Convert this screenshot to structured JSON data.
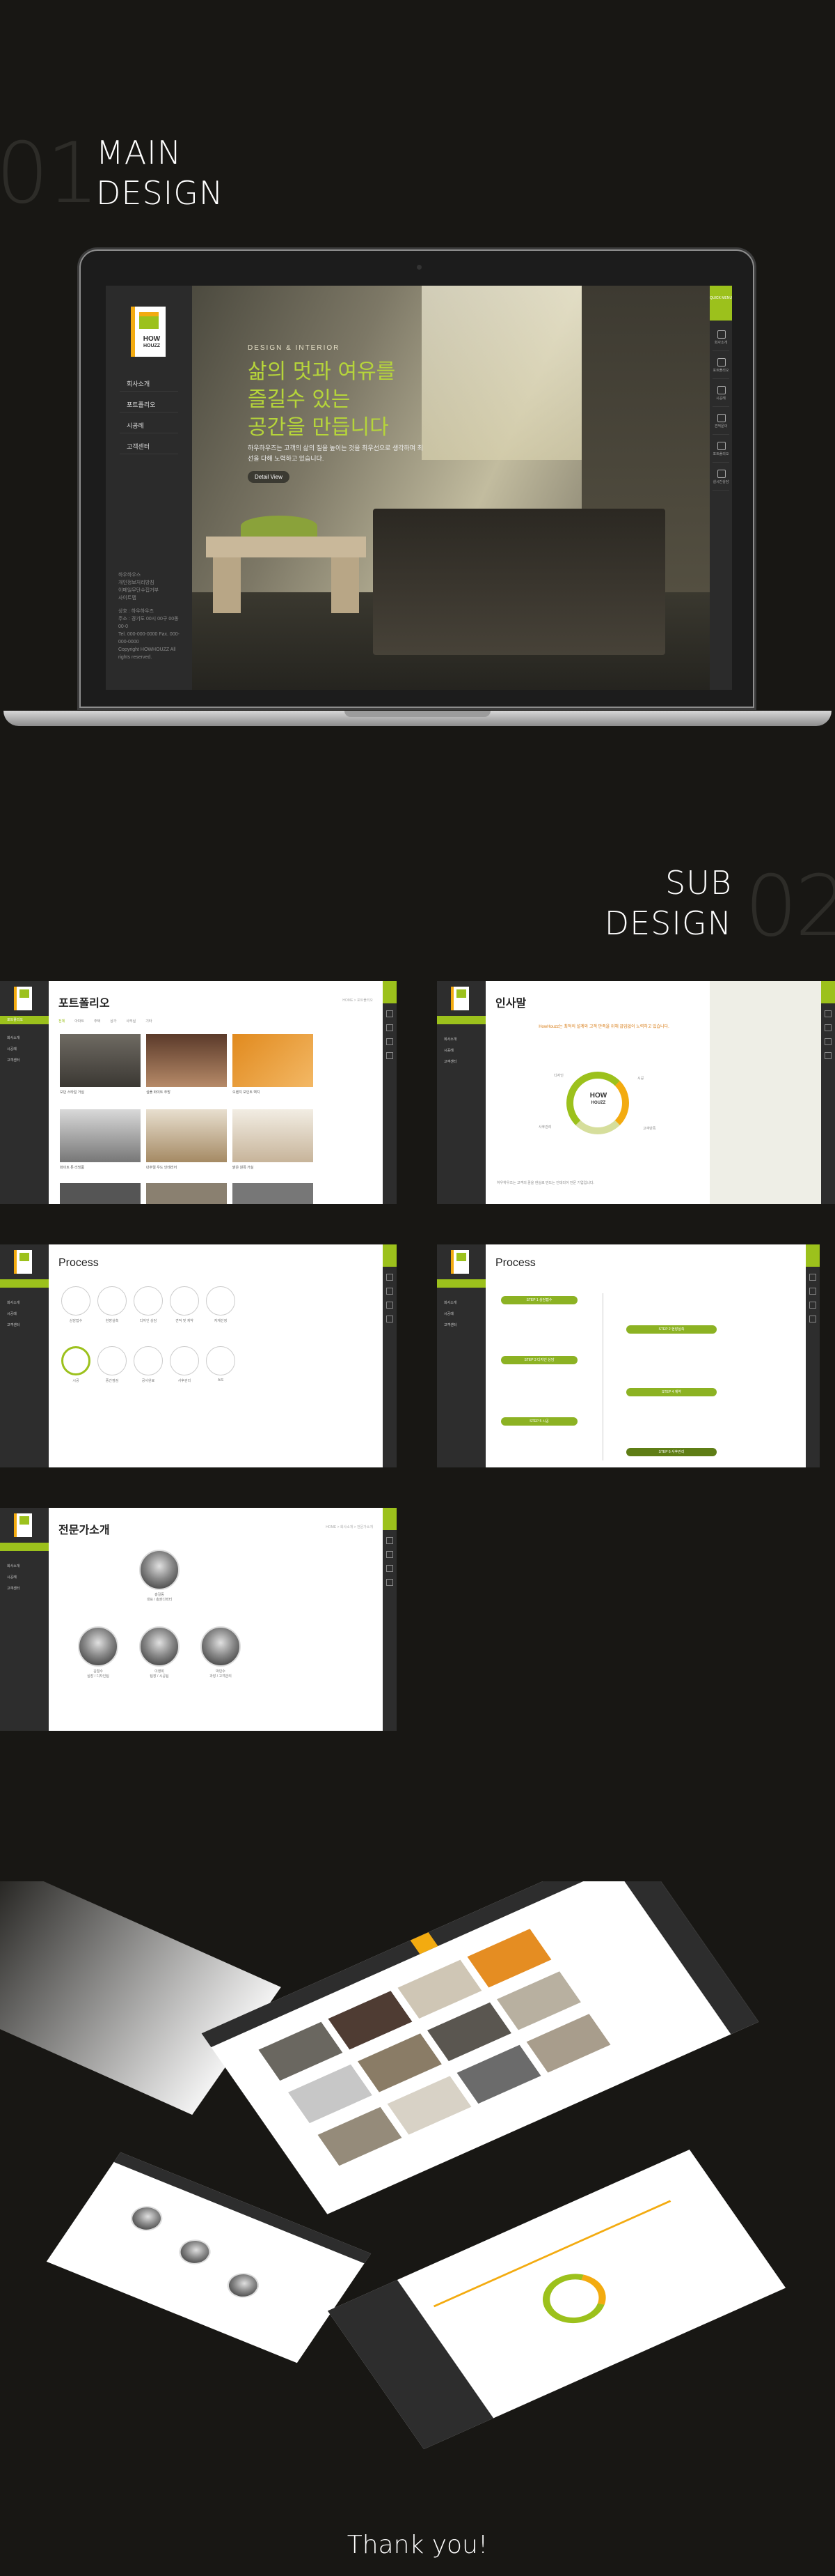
{
  "main_section": {
    "number": "01",
    "title_line1": "MAIN",
    "title_line2": "DESIGN"
  },
  "sub_section": {
    "number": "02",
    "title_line1": "SUB",
    "title_line2": "DESIGN"
  },
  "brand": {
    "logo_line1": "HOW",
    "logo_line2": "HOUZZ",
    "accent": "#9cc11c",
    "orange": "#f3ab10",
    "background": "#181714"
  },
  "main_screen": {
    "menu": [
      "회사소개",
      "포트폴리오",
      "시공례",
      "고객센터"
    ],
    "info_lines": [
      "하우하우스",
      "개인정보처리방침",
      "이메일무단수집거부",
      "사이트맵"
    ],
    "info_small": [
      "상호 : 하우하우즈",
      "주소 : 경기도 00시 00구 00동 00-0",
      "Tel. 000-000-0000 Fax. 000-000-0000",
      "Copyright HOWHOUZZ All rights reserved."
    ],
    "hero_tag": "DESIGN & INTERIOR",
    "hero_title_1": "삶의 멋과 여유를",
    "hero_title_2": "즐길수 있는",
    "hero_title_3": "공간을 만듭니다",
    "hero_desc": "하우하우즈는 고객의 삶의 질을 높이는 것을 최우선으로 생각하며 최선을 다해 노력하고 있습니다.",
    "hero_button": "Detail View",
    "quick_badge": "QUICK MENU",
    "quick_items": [
      "회사소개",
      "포트폴리오",
      "시공례",
      "견적문의",
      "포트폴리오",
      "실시간상담"
    ]
  },
  "sub_pages": {
    "side_menu": [
      "포트폴리오",
      "회사소개",
      "시공례",
      "고객센터"
    ],
    "portfolio": {
      "title": "포트폴리오",
      "crumb": "HOME > 포트폴리오",
      "filters": [
        "전체",
        "아파트",
        "주택",
        "상가",
        "사무실",
        "기타"
      ],
      "items": [
        "모던 스타일 거실",
        "심플 화이트 주방",
        "오렌지 포인트 벽지",
        "화이트 톤 리빙룸",
        "내추럴 우드 인테리어",
        "밝은 원목 거실"
      ]
    },
    "greeting": {
      "title": "인사말",
      "lead": "HowHouzz는 최적의 설계와 고객 만족을 위해 끊임없이 노력하고 있습니다.",
      "labels": [
        "디자인",
        "시공",
        "사후관리",
        "고객만족"
      ],
      "footer": "하우하우즈는 고객의 꿈을 현실로 만드는 인테리어 전문 기업입니다."
    },
    "process_icons": {
      "title": "Process",
      "steps": [
        "상담접수",
        "현장실측",
        "디자인 상담",
        "견적 및 계약",
        "자재선정",
        "시공",
        "중간점검",
        "공사완료",
        "사후관리",
        "A/S"
      ]
    },
    "process_timeline": {
      "title": "Process",
      "steps": [
        "STEP 1 상담접수",
        "STEP 2 현장실측",
        "STEP 3 디자인 상담",
        "STEP 4 계약",
        "STEP 5 시공",
        "STEP 6 사후관리"
      ]
    },
    "experts": {
      "title": "전문가소개",
      "crumb": "HOME > 회사소개 > 전문가소개",
      "people": [
        {
          "name": "홍길동",
          "role": "대표 / 총괄디렉터"
        },
        {
          "name": "김철수",
          "role": "실장 / 디자인팀"
        },
        {
          "name": "이영희",
          "role": "팀장 / 시공팀"
        },
        {
          "name": "박민수",
          "role": "과장 / 고객관리"
        }
      ]
    }
  },
  "closing": {
    "text": "Thank you!"
  }
}
